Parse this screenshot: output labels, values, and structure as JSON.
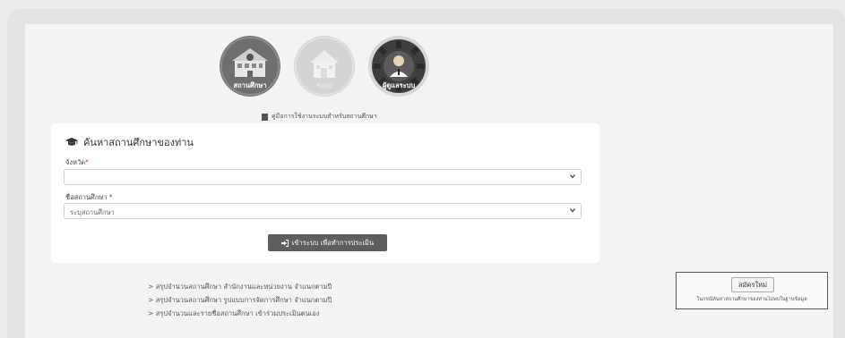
{
  "roles": [
    {
      "label": "สถานศึกษา",
      "icon": "school-icon"
    },
    {
      "label": "ระบบ",
      "icon": "house-icon"
    },
    {
      "label": "ผู้ดูแลระบบ",
      "icon": "admin-gear-icon"
    }
  ],
  "manual_link": "คู่มือการใช้งานระบบสำหรับสถานศึกษา",
  "search": {
    "title": "ค้นหาสถานศึกษาของท่าน",
    "province_label": "จังหวัด",
    "province_value": "",
    "school_label": "ชื่อสถานศึกษา",
    "school_placeholder": "ระบุสถานศึกษา",
    "required_mark": "*",
    "login_button": "เข้าระบบ เพื่อทำการประเมิน"
  },
  "summary_links": [
    "สรุปจำนวนสถานศึกษา สำนักงานและหน่วยงาน จำแนกตามปี",
    "สรุปจำนวนสถานศึกษา รูปแบบการจัดการศึกษา จำแนกตามปี",
    "สรุปจำนวนและรายชื่อสถานศึกษา เข้าร่วมประเมินตนเอง"
  ],
  "link_prefix": ">",
  "register": {
    "button": "สมัครใหม่",
    "note": "ในกรณีค้นหาสถานศึกษาของท่านไม่พบในฐานข้อมูล"
  },
  "colors": {
    "role_school_bg": "#6f6f6f",
    "role_house_bg": "#d4d4d4",
    "role_admin_bg": "#4a4a4a",
    "button_bg": "#5e5e5e"
  }
}
